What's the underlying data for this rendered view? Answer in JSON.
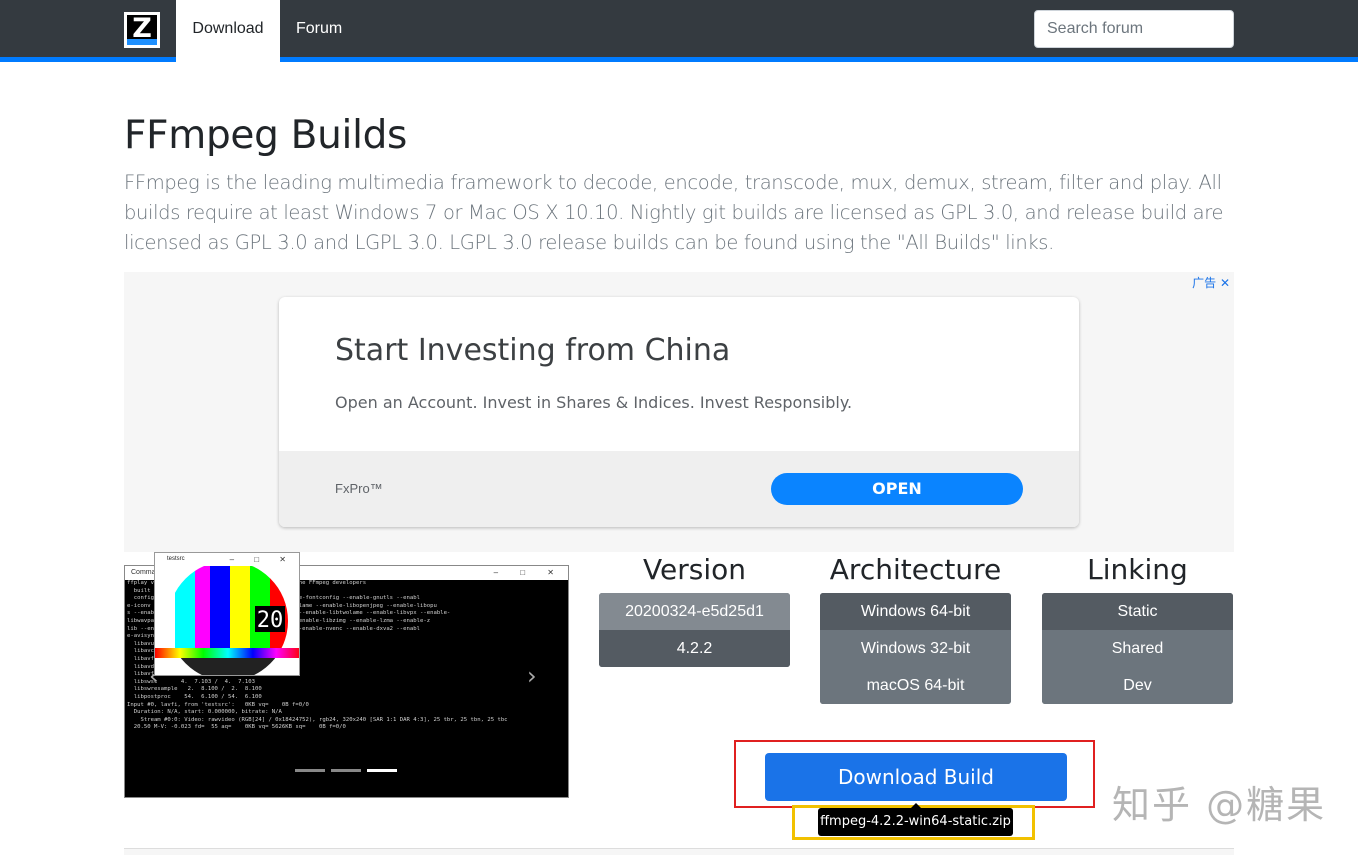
{
  "navbar": {
    "logo_letter": "Z",
    "tabs": [
      {
        "label": "Download",
        "active": true
      },
      {
        "label": "Forum",
        "active": false
      }
    ],
    "search_placeholder": "Search forum"
  },
  "page": {
    "title": "FFmpeg Builds",
    "lead": "FFmpeg is the leading multimedia framework to decode, encode, transcode, mux, demux, stream, filter and play. All builds require at least Windows 7 or Mac OS X 10.10. Nightly git builds are licensed as GPL 3.0, and release build are licensed as GPL 3.0 and LGPL 3.0. LGPL 3.0 release builds can be found using the \"All Builds\" links."
  },
  "ad": {
    "badge": "广告 ✕",
    "headline": "Start Investing from China",
    "description": "Open an Account. Invest in Shares & Indices. Invest Responsibly.",
    "brand": "FxPro™",
    "cta": "OPEN"
  },
  "carousel": {
    "window_title": "Command Prompt",
    "terminal_lines": [
      "ffplay version ...        Copyright (c) 2003-2017 the FFmpeg developers",
      "  built",
      "  configu      --enable-sdl2 --enable-bzlib --enable-fontconfig --enable-gnutls --enabl",
      "e-iconv        --enable-libfreetype --enable-libmp3lame --enable-libopenjpeg --enable-libopu",
      "s --enab       --enable-libsoxr --enable-libtheora --enable-libtwolame --enable-libvpx --enable-",
      "libwavpa       --enable-libx265 --enable-libxml2 --enable-libzimg --enable-lzma --enable-z",
      "lib --en       da --enable-cuvid --enable-d3d11va --enable-nvenc --enable-dxva2 --enabl",
      "e-avisyn",
      "  libavu",
      "  libavc",
      "  libavf",
      "  libavd",
      "  libavf",
      "  libswsc       4.  7.103 /  4.  7.103",
      "  libswresample   2.  8.100 /  2.  8.100",
      "  libpostproc    54.  6.100 / 54.  6.100",
      "Input #0, lavfi, from 'testsrc':   0KB vq=    0B f=0/0",
      "  Duration: N/A, start: 0.000000, bitrate: N/A",
      "    Stream #0:0: Video: rawvideo (RGB[24] / 0x18424752), rgb24, 320x240 [SAR 1:1 DAR 4:3], 25 tbr, 25 tbn, 25 tbc",
      "  20.50 M-V: -0.023 fd=  55 aq=    0KB vq= 5626KB sq=    0B f=0/0"
    ],
    "window_controls": "–  □  ✕",
    "testsrc_title": "testsrc",
    "testsrc_counter": "20",
    "prev_icon": "‹",
    "next_icon": "›",
    "active_indicator": 3
  },
  "options": {
    "version": {
      "heading": "Version",
      "items": [
        "20200324-e5d25d1",
        "4.2.2"
      ],
      "selected": 1
    },
    "architecture": {
      "heading": "Architecture",
      "items": [
        "Windows 64-bit",
        "Windows 32-bit",
        "macOS 64-bit"
      ],
      "selected": 0
    },
    "linking": {
      "heading": "Linking",
      "items": [
        "Static",
        "Shared",
        "Dev"
      ],
      "selected": 0
    }
  },
  "download": {
    "button_label": "Download Build",
    "tooltip": "ffmpeg-4.2.2-win64-static.zip"
  },
  "watermark": "知乎 @糖果"
}
